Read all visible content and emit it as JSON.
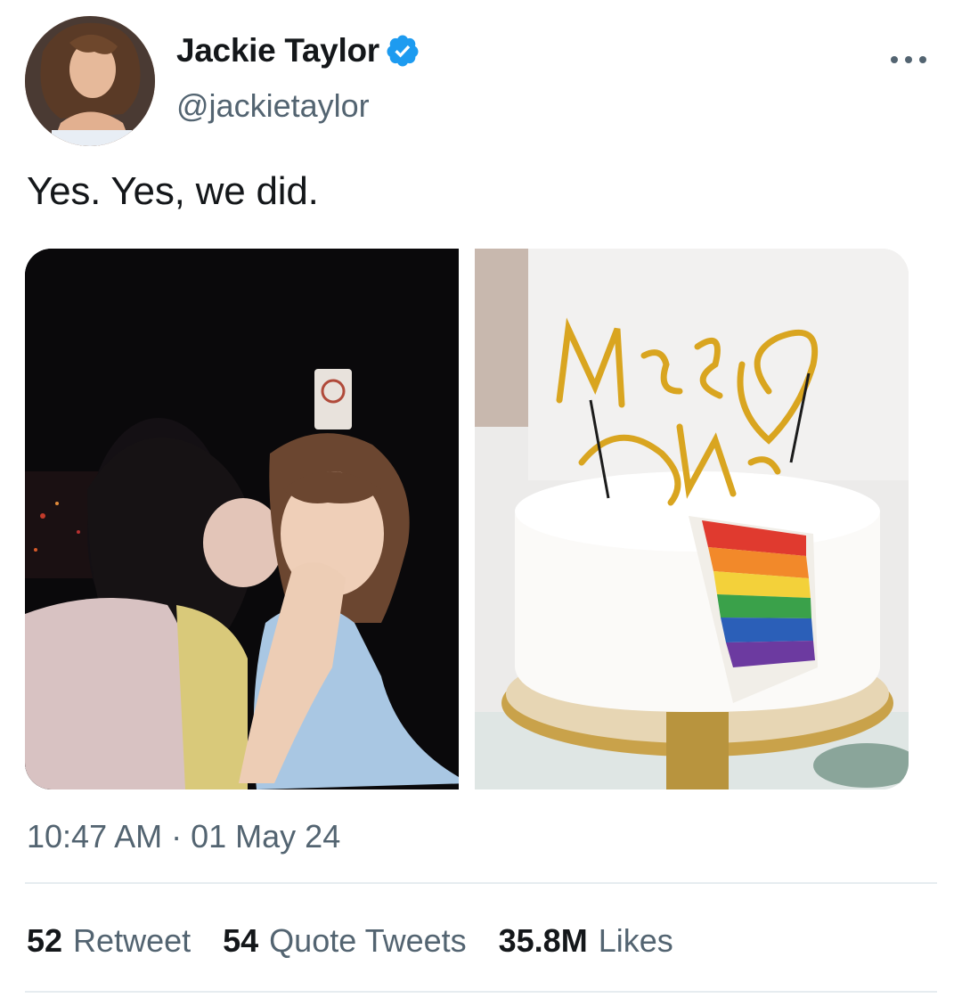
{
  "author": {
    "display_name": "Jackie Taylor",
    "handle": "@jackietaylor",
    "verified": true,
    "verified_color": "#1d9bf0"
  },
  "tweet": {
    "text": "Yes. Yes, we did.",
    "time": "10:47 AM",
    "separator": "·",
    "date": "01 May 24"
  },
  "media": {
    "topper_text": "Mrs & Mrs"
  },
  "stats": [
    {
      "count": "52",
      "label": "Retweet"
    },
    {
      "count": "54",
      "label": "Quote Tweets"
    },
    {
      "count": "35.8M",
      "label": "Likes"
    }
  ],
  "colors": {
    "text_primary": "#14171a",
    "text_secondary": "#536471",
    "divider": "#e6ecf0"
  },
  "icons": {
    "verified": "verified-badge-icon",
    "more": "more-options-icon"
  }
}
